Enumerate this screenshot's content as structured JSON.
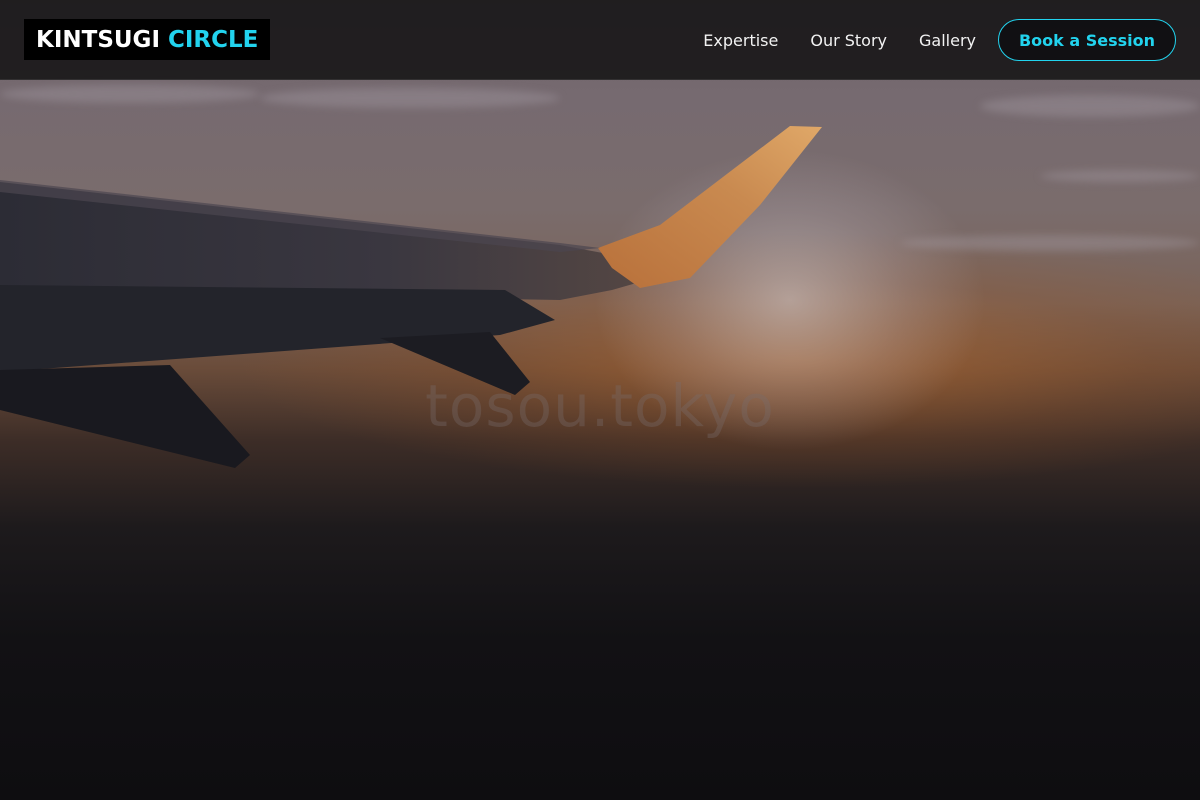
{
  "brand": {
    "name_primary": "KINTSUGI",
    "name_accent": "CIRCLE",
    "accent_color": "#22d3ee"
  },
  "nav": {
    "links": [
      "Expertise",
      "Our Story",
      "Gallery"
    ],
    "cta_label": "Book a Session"
  },
  "hero": {
    "watermark_text": "tosou.tokyo",
    "image_subject": "airplane-wing-at-sunset"
  }
}
